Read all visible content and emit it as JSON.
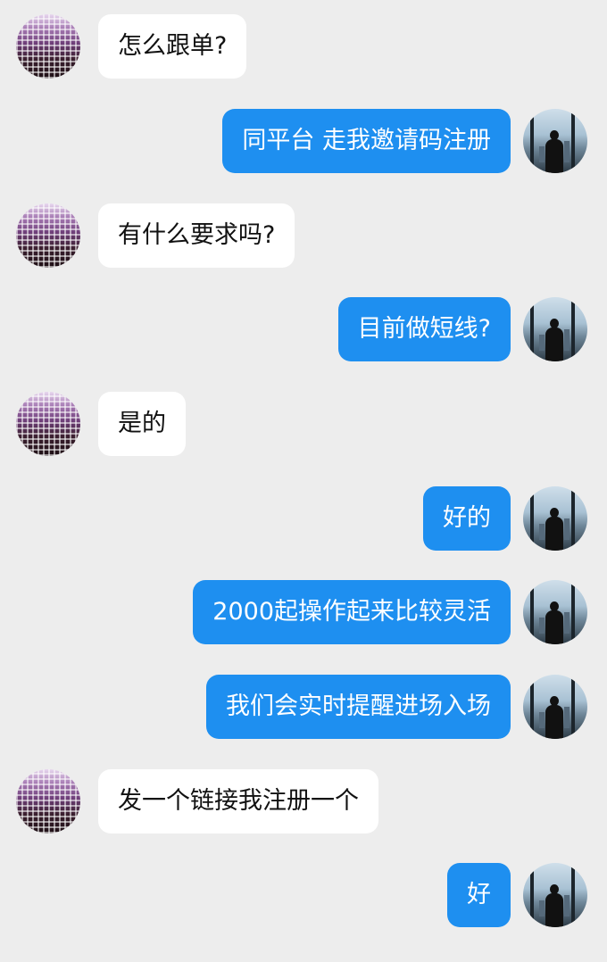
{
  "messages": [
    {
      "side": "left",
      "text": "怎么跟单?"
    },
    {
      "side": "right",
      "text": "同平台 走我邀请码注册"
    },
    {
      "side": "left",
      "text": "有什么要求吗?"
    },
    {
      "side": "right",
      "text": "目前做短线?"
    },
    {
      "side": "left",
      "text": "是的"
    },
    {
      "side": "right",
      "text": "好的"
    },
    {
      "side": "right",
      "text": "2000起操作起来比较灵活"
    },
    {
      "side": "right",
      "text": "我们会实时提醒进场入场"
    },
    {
      "side": "left",
      "text": "发一个链接我注册一个"
    },
    {
      "side": "right",
      "text": "好"
    }
  ],
  "colors": {
    "background": "#ededed",
    "outgoing_bubble": "#1e8ff0",
    "incoming_bubble": "#ffffff"
  }
}
